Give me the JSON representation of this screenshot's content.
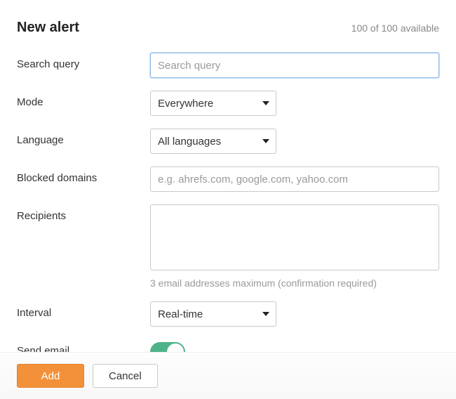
{
  "header": {
    "title": "New alert",
    "available_text": "100 of 100 available"
  },
  "form": {
    "search_query": {
      "label": "Search query",
      "placeholder": "Search query",
      "value": ""
    },
    "mode": {
      "label": "Mode",
      "selected": "Everywhere"
    },
    "language": {
      "label": "Language",
      "selected": "All languages"
    },
    "blocked_domains": {
      "label": "Blocked domains",
      "placeholder": "e.g. ahrefs.com, google.com, yahoo.com",
      "value": ""
    },
    "recipients": {
      "label": "Recipients",
      "value": "",
      "help_text": "3 email addresses maximum (confirmation required)"
    },
    "interval": {
      "label": "Interval",
      "selected": "Real-time"
    },
    "send_email": {
      "label": "Send email",
      "enabled": true
    }
  },
  "footer": {
    "add_label": "Add",
    "cancel_label": "Cancel"
  }
}
